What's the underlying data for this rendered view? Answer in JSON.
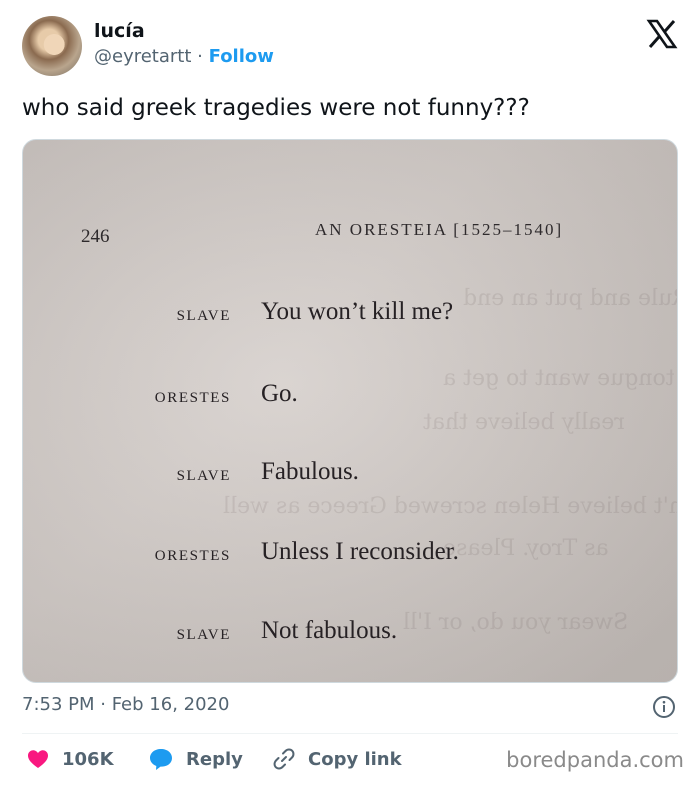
{
  "user": {
    "display_name": "lucía ⁣⁣",
    "handle": "@eyretartt",
    "separator": "·",
    "follow_label": "Follow"
  },
  "tweet": {
    "text": "who said greek tragedies were not funny???"
  },
  "photo": {
    "page_number": "246",
    "running_head": "AN ORESTEIA [1525–1540]",
    "lines": [
      {
        "speaker": "SLAVE",
        "speech": "You won’t kill me?"
      },
      {
        "speaker": "ORESTES",
        "speech": "Go."
      },
      {
        "speaker": "SLAVE",
        "speech": "Fabulous."
      },
      {
        "speaker": "ORESTES",
        "speech": "Unless I reconsider."
      },
      {
        "speaker": "SLAVE",
        "speech": "Not fabulous."
      }
    ]
  },
  "footer": {
    "timestamp": "7:53 PM · Feb 16, 2020"
  },
  "actions": {
    "like_count": "106K",
    "reply_label": "Reply",
    "copy_label": "Copy link"
  },
  "watermark": "boredpanda.com",
  "colors": {
    "accent": "#1d9bf0",
    "like": "#f91880",
    "muted": "#536471"
  }
}
